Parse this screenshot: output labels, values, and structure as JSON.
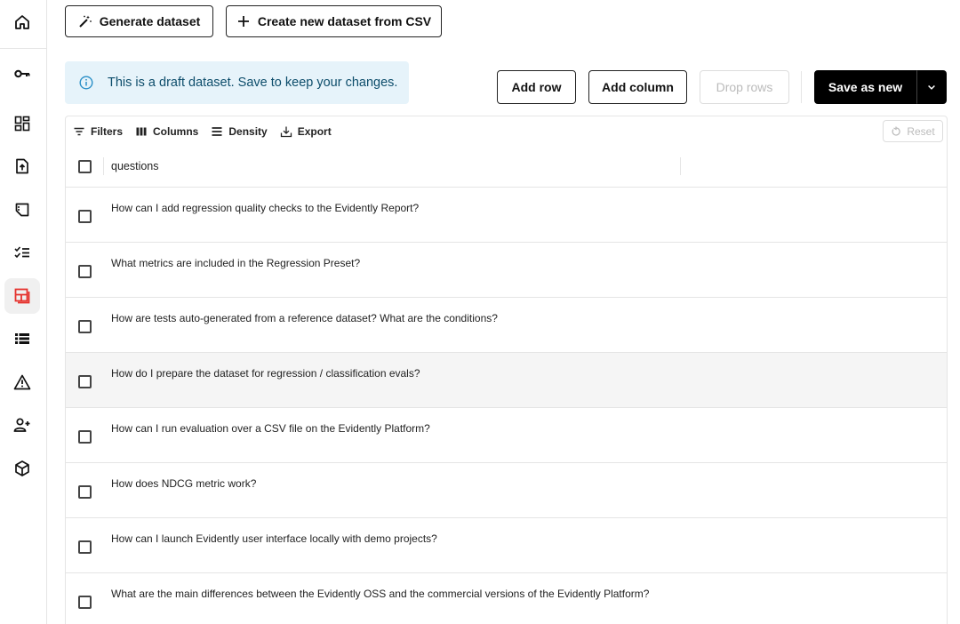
{
  "sidebar": {
    "items": [
      {
        "icon": "home-icon"
      },
      {
        "icon": "key-icon"
      },
      {
        "icon": "dashboard-icon"
      },
      {
        "icon": "upload-file-icon"
      },
      {
        "icon": "document-icon"
      },
      {
        "icon": "checklist-icon"
      },
      {
        "icon": "datasets-icon",
        "active": true
      },
      {
        "icon": "list-icon"
      },
      {
        "icon": "warning-icon"
      },
      {
        "icon": "add-user-icon"
      },
      {
        "icon": "cube-icon"
      }
    ]
  },
  "top_actions": {
    "generate_label": "Generate dataset",
    "create_csv_label": "Create new dataset from CSV"
  },
  "alert": {
    "text": "This is a draft dataset. Save to keep your changes."
  },
  "actions": {
    "add_row": "Add row",
    "add_column": "Add column",
    "drop_rows": "Drop rows",
    "save_as_new": "Save as new"
  },
  "toolbar": {
    "filters": "Filters",
    "columns": "Columns",
    "density": "Density",
    "export": "Export",
    "reset": "Reset"
  },
  "table": {
    "column_header": "questions",
    "rows": [
      "How can I add regression quality checks to the Evidently Report?",
      "What metrics are included in the Regression Preset?",
      "How are tests auto-generated from a reference dataset? What are the conditions?",
      "How do I prepare the dataset for regression / classification evals?",
      "How can I run evaluation over a CSV file on the Evidently Platform?",
      "How does NDCG metric work?",
      "How can I launch Evidently user interface locally with demo projects?",
      "What are the main differences between the Evidently OSS and the commercial versions of the Evidently Platform?"
    ],
    "highlighted_row": 3
  },
  "colors": {
    "active_icon": "#e5322d",
    "alert_bg": "#e6f3fa",
    "alert_text": "#0d4d6b",
    "primary_button": "#000000"
  }
}
